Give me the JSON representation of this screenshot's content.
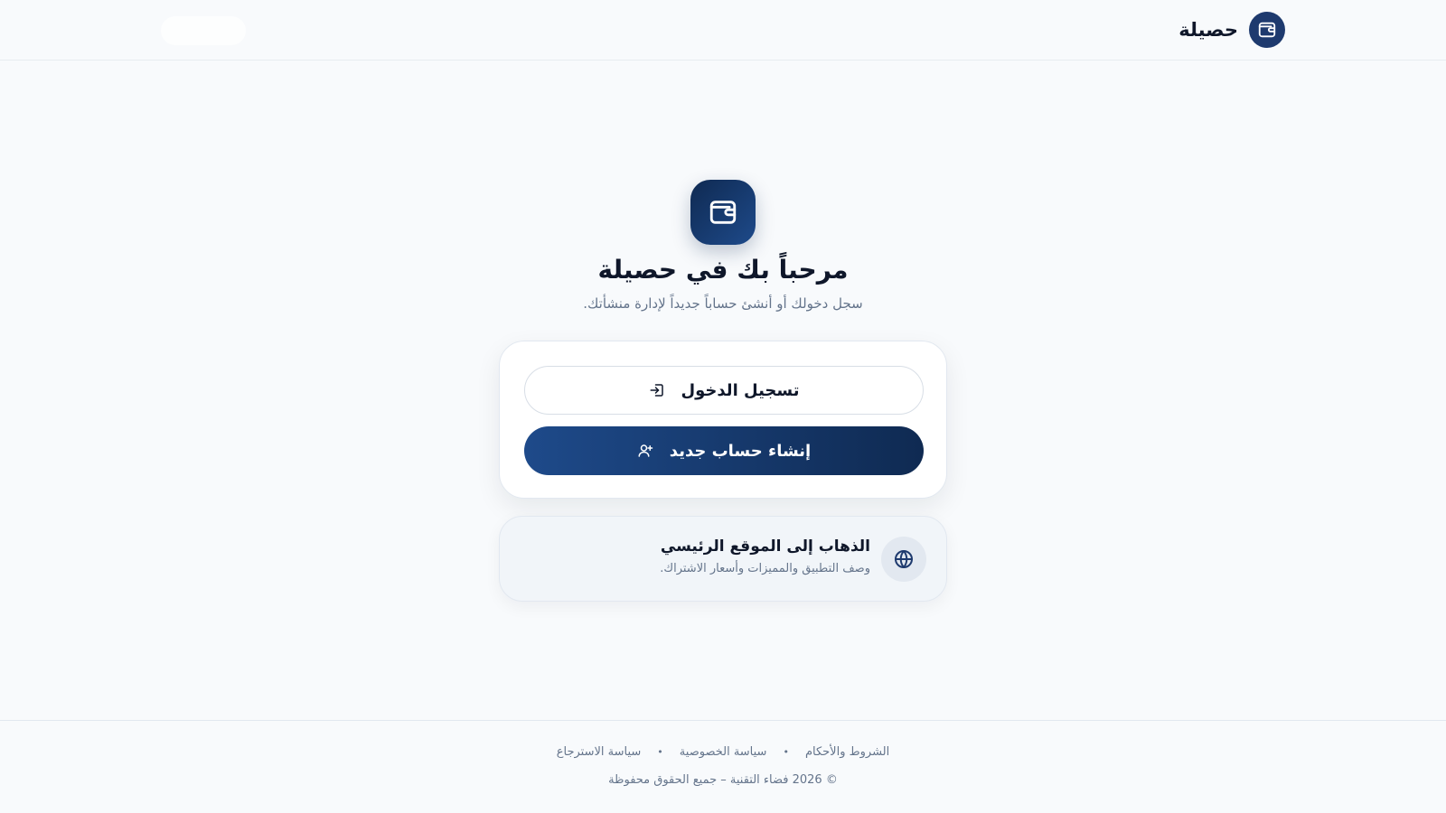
{
  "header": {
    "brand_name": "حصيلة"
  },
  "hero": {
    "title": "مرحباً بك في حصيلة",
    "subtitle": "سجل دخولك أو أنشئ حساباً جديداً لإدارة منشأتك."
  },
  "auth": {
    "login_label": "تسجيل الدخول",
    "signup_label": "إنشاء حساب جديد"
  },
  "website_link": {
    "title": "الذهاب إلى الموقع الرئيسي",
    "description": "وصف التطبيق والمميزات وأسعار الاشتراك."
  },
  "footer": {
    "links": [
      "الشروط والأحكام",
      "سياسة الخصوصية",
      "سياسة الاسترجاع"
    ],
    "separator": "•",
    "copyright": "© 2026 فضاء التقنية – جميع الحقوق محفوظة"
  },
  "colors": {
    "primary": "#1e3a6e",
    "primary_dark": "#0f2a52",
    "background": "#f8fafc",
    "muted_text": "#64748b"
  },
  "icons": {
    "brand": "wallet-icon",
    "login": "login-icon",
    "signup": "user-plus-icon",
    "website": "globe-icon"
  }
}
